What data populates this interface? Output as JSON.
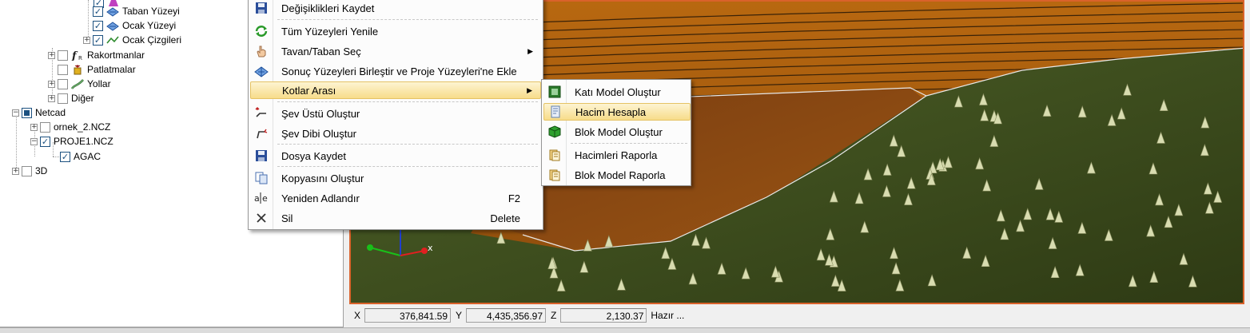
{
  "tree": {
    "items": [
      {
        "label": "Taban Yüzeyi"
      },
      {
        "label": "Ocak Yüzeyi"
      },
      {
        "label": "Ocak Çizgileri"
      },
      {
        "label": "Rakortmanlar"
      },
      {
        "label": "Patlatmalar"
      },
      {
        "label": "Yollar"
      },
      {
        "label": "Diğer"
      },
      {
        "label": "Netcad"
      },
      {
        "label": "ornek_2.NCZ"
      },
      {
        "label": "PROJE1.NCZ"
      },
      {
        "label": "AGAC"
      },
      {
        "label": "3D"
      }
    ]
  },
  "context_menu": {
    "items": [
      {
        "label": "Değişiklikleri Kaydet",
        "icon": "save-icon"
      },
      {
        "label": "Tüm Yüzeyleri Yenile",
        "icon": "refresh-icon"
      },
      {
        "label": "Tavan/Taban Seç",
        "icon": "hand-icon"
      },
      {
        "label": "Sonuç Yüzeyleri Birleştir ve Proje Yüzeyleri'ne Ekle",
        "icon": "merge-surfaces-icon"
      },
      {
        "label": "Kotlar Arası",
        "icon": ""
      },
      {
        "label": "Şev Üstü Oluştur",
        "icon": "slope-top-icon"
      },
      {
        "label": "Şev Dibi Oluştur",
        "icon": "slope-bottom-icon"
      },
      {
        "label": "Dosya Kaydet",
        "icon": "save-file-icon"
      },
      {
        "label": "Kopyasını Oluştur",
        "icon": "copy-icon"
      },
      {
        "label": "Yeniden Adlandır",
        "icon": "rename-icon",
        "shortcut": "F2"
      },
      {
        "label": "Sil",
        "icon": "delete-icon",
        "shortcut": "Delete"
      }
    ]
  },
  "submenu": {
    "items": [
      {
        "label": "Katı Model Oluştur",
        "icon": "solid-model-icon"
      },
      {
        "label": "Hacim Hesapla",
        "icon": "volume-calc-icon"
      },
      {
        "label": "Blok Model Oluştur",
        "icon": "block-model-icon"
      },
      {
        "label": "Hacimleri Raporla",
        "icon": "report-icon"
      },
      {
        "label": "Blok Model Raporla",
        "icon": "report-icon"
      }
    ]
  },
  "viewport": {
    "axis_label": "x"
  },
  "statusbar": {
    "x_label": "X",
    "x_value": "376,841.59",
    "y_label": "Y",
    "y_value": "4,435,356.97",
    "z_label": "Z",
    "z_value": "2,130.37",
    "message": "Hazır ..."
  },
  "colors": {
    "accent_border": "#d9622b",
    "menu_highlight": "#f7dc8a",
    "terrain_green": "#3d4a1c",
    "pit_orange": "#c06a10"
  }
}
